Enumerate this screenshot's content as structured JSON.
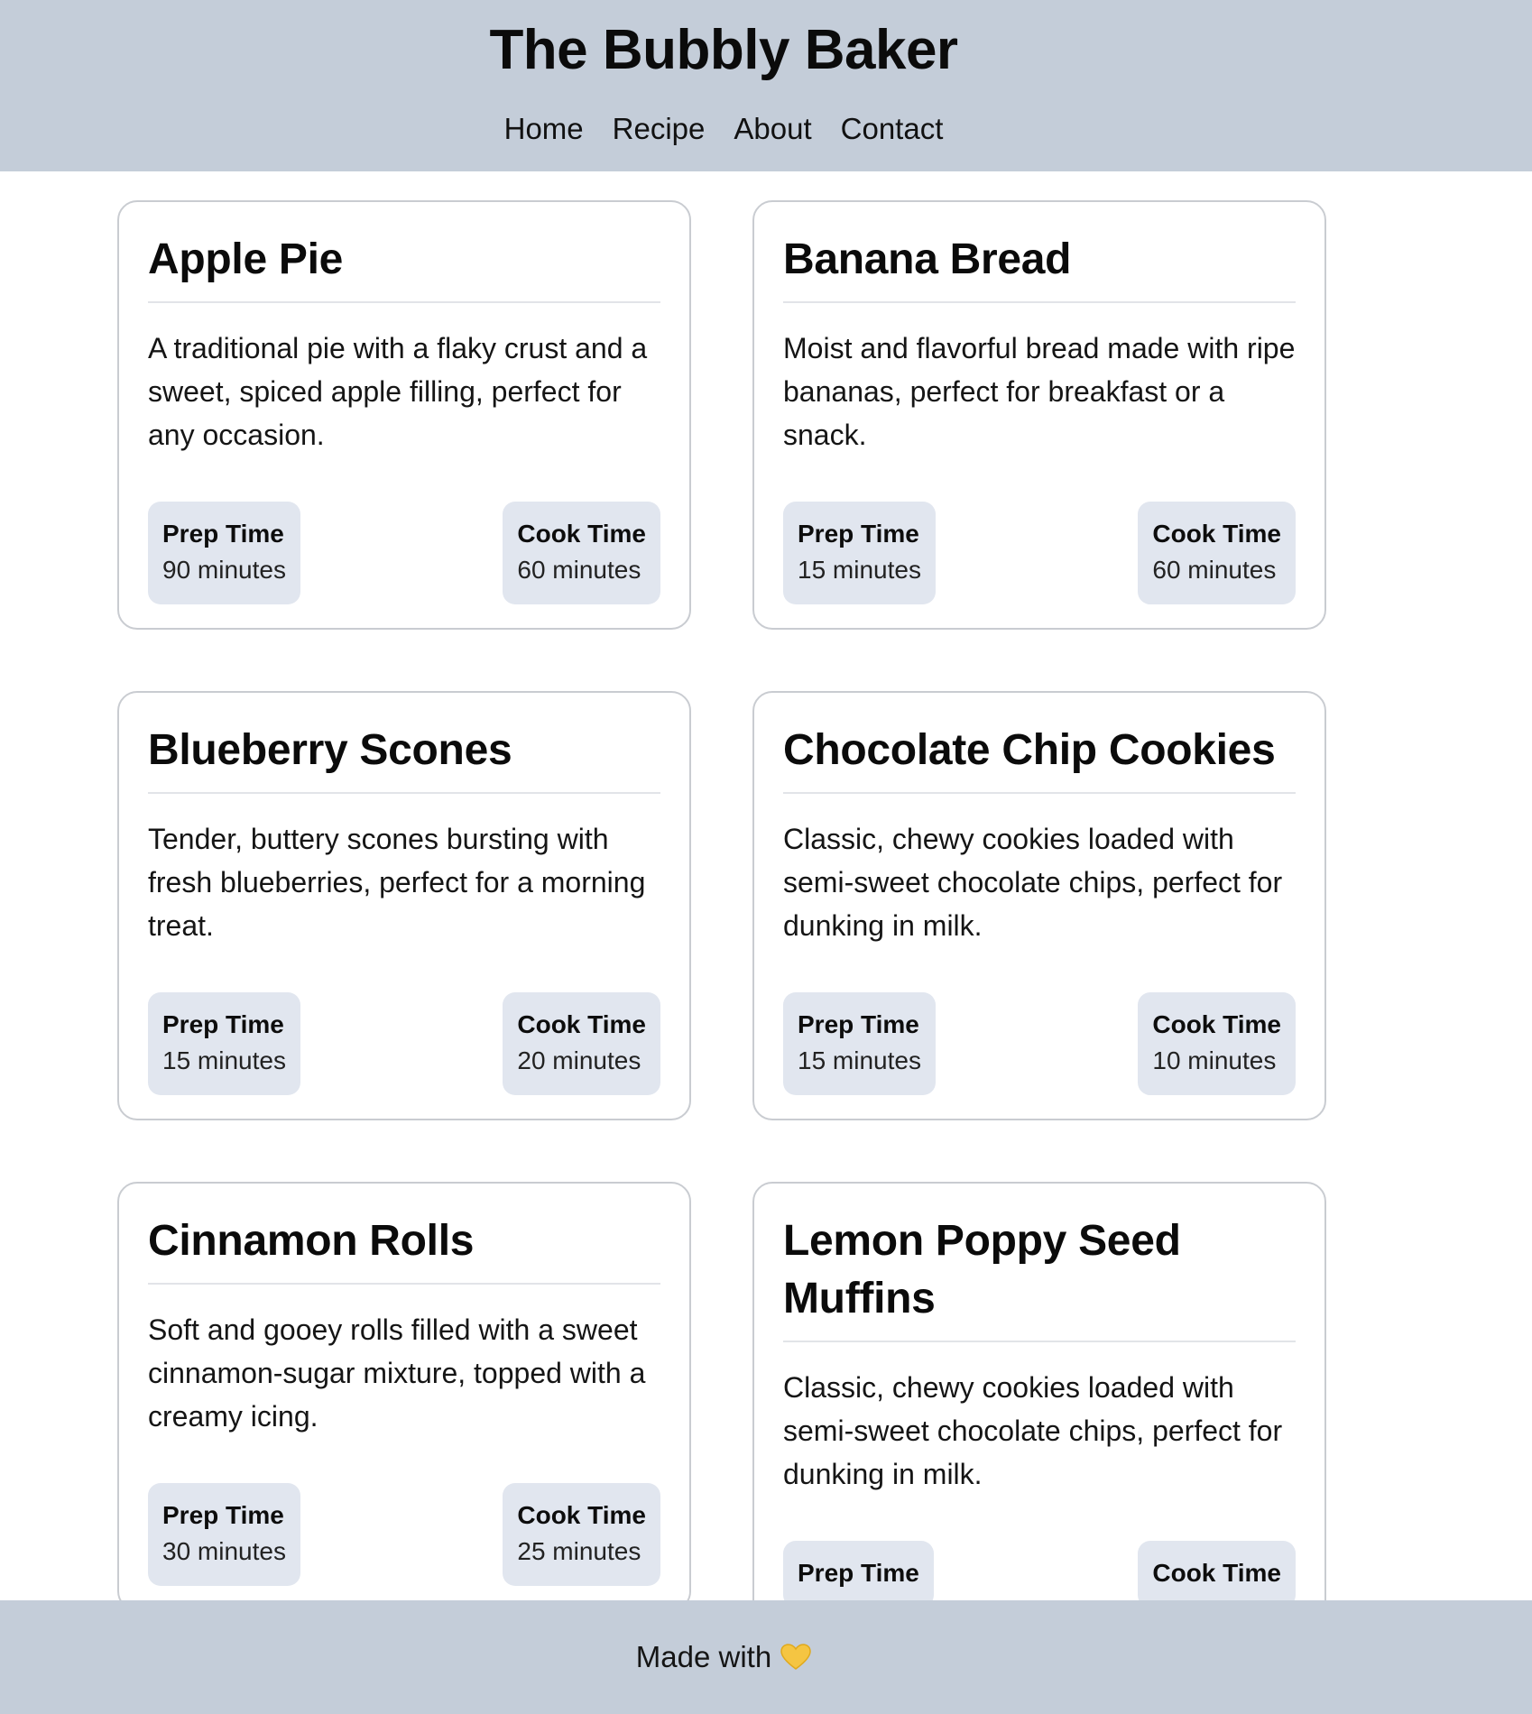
{
  "header": {
    "title": "The Bubbly Baker",
    "nav": [
      "Home",
      "Recipe",
      "About",
      "Contact"
    ]
  },
  "recipes": [
    {
      "title": "Apple Pie",
      "description": "A traditional pie with a flaky crust and a sweet, spiced apple filling, perfect for any occasion.",
      "prep_label": "Prep Time",
      "prep_value": "90 minutes",
      "cook_label": "Cook Time",
      "cook_value": "60 minutes"
    },
    {
      "title": "Banana Bread",
      "description": "Moist and flavorful bread made with ripe bananas, perfect for breakfast or a snack.",
      "prep_label": "Prep Time",
      "prep_value": "15 minutes",
      "cook_label": "Cook Time",
      "cook_value": "60 minutes"
    },
    {
      "title": "Blueberry Scones",
      "description": "Tender, buttery scones bursting with fresh blueberries, perfect for a morning treat.",
      "prep_label": "Prep Time",
      "prep_value": "15 minutes",
      "cook_label": "Cook Time",
      "cook_value": "20 minutes"
    },
    {
      "title": "Chocolate Chip Cookies",
      "description": "Classic, chewy cookies loaded with semi-sweet chocolate chips, perfect for dunking in milk.",
      "prep_label": "Prep Time",
      "prep_value": "15 minutes",
      "cook_label": "Cook Time",
      "cook_value": "10 minutes"
    },
    {
      "title": "Cinnamon Rolls",
      "description": "Soft and gooey rolls filled with a sweet cinnamon-sugar mixture, topped with a creamy icing.",
      "prep_label": "Prep Time",
      "prep_value": "30 minutes",
      "cook_label": "Cook Time",
      "cook_value": "25 minutes"
    },
    {
      "title": "Lemon Poppy Seed Muffins",
      "description": "Classic, chewy cookies loaded with semi-sweet chocolate chips, perfect for dunking in milk.",
      "prep_label": "Prep Time",
      "prep_value": "",
      "cook_label": "Cook Time",
      "cook_value": ""
    }
  ],
  "footer": {
    "text": "Made with",
    "icon": "heart-icon",
    "icon_color": "#f5c542"
  },
  "colors": {
    "header_bg": "#c4cdd9",
    "badge_bg": "#e1e6ef",
    "card_border": "#c9ccd1"
  }
}
